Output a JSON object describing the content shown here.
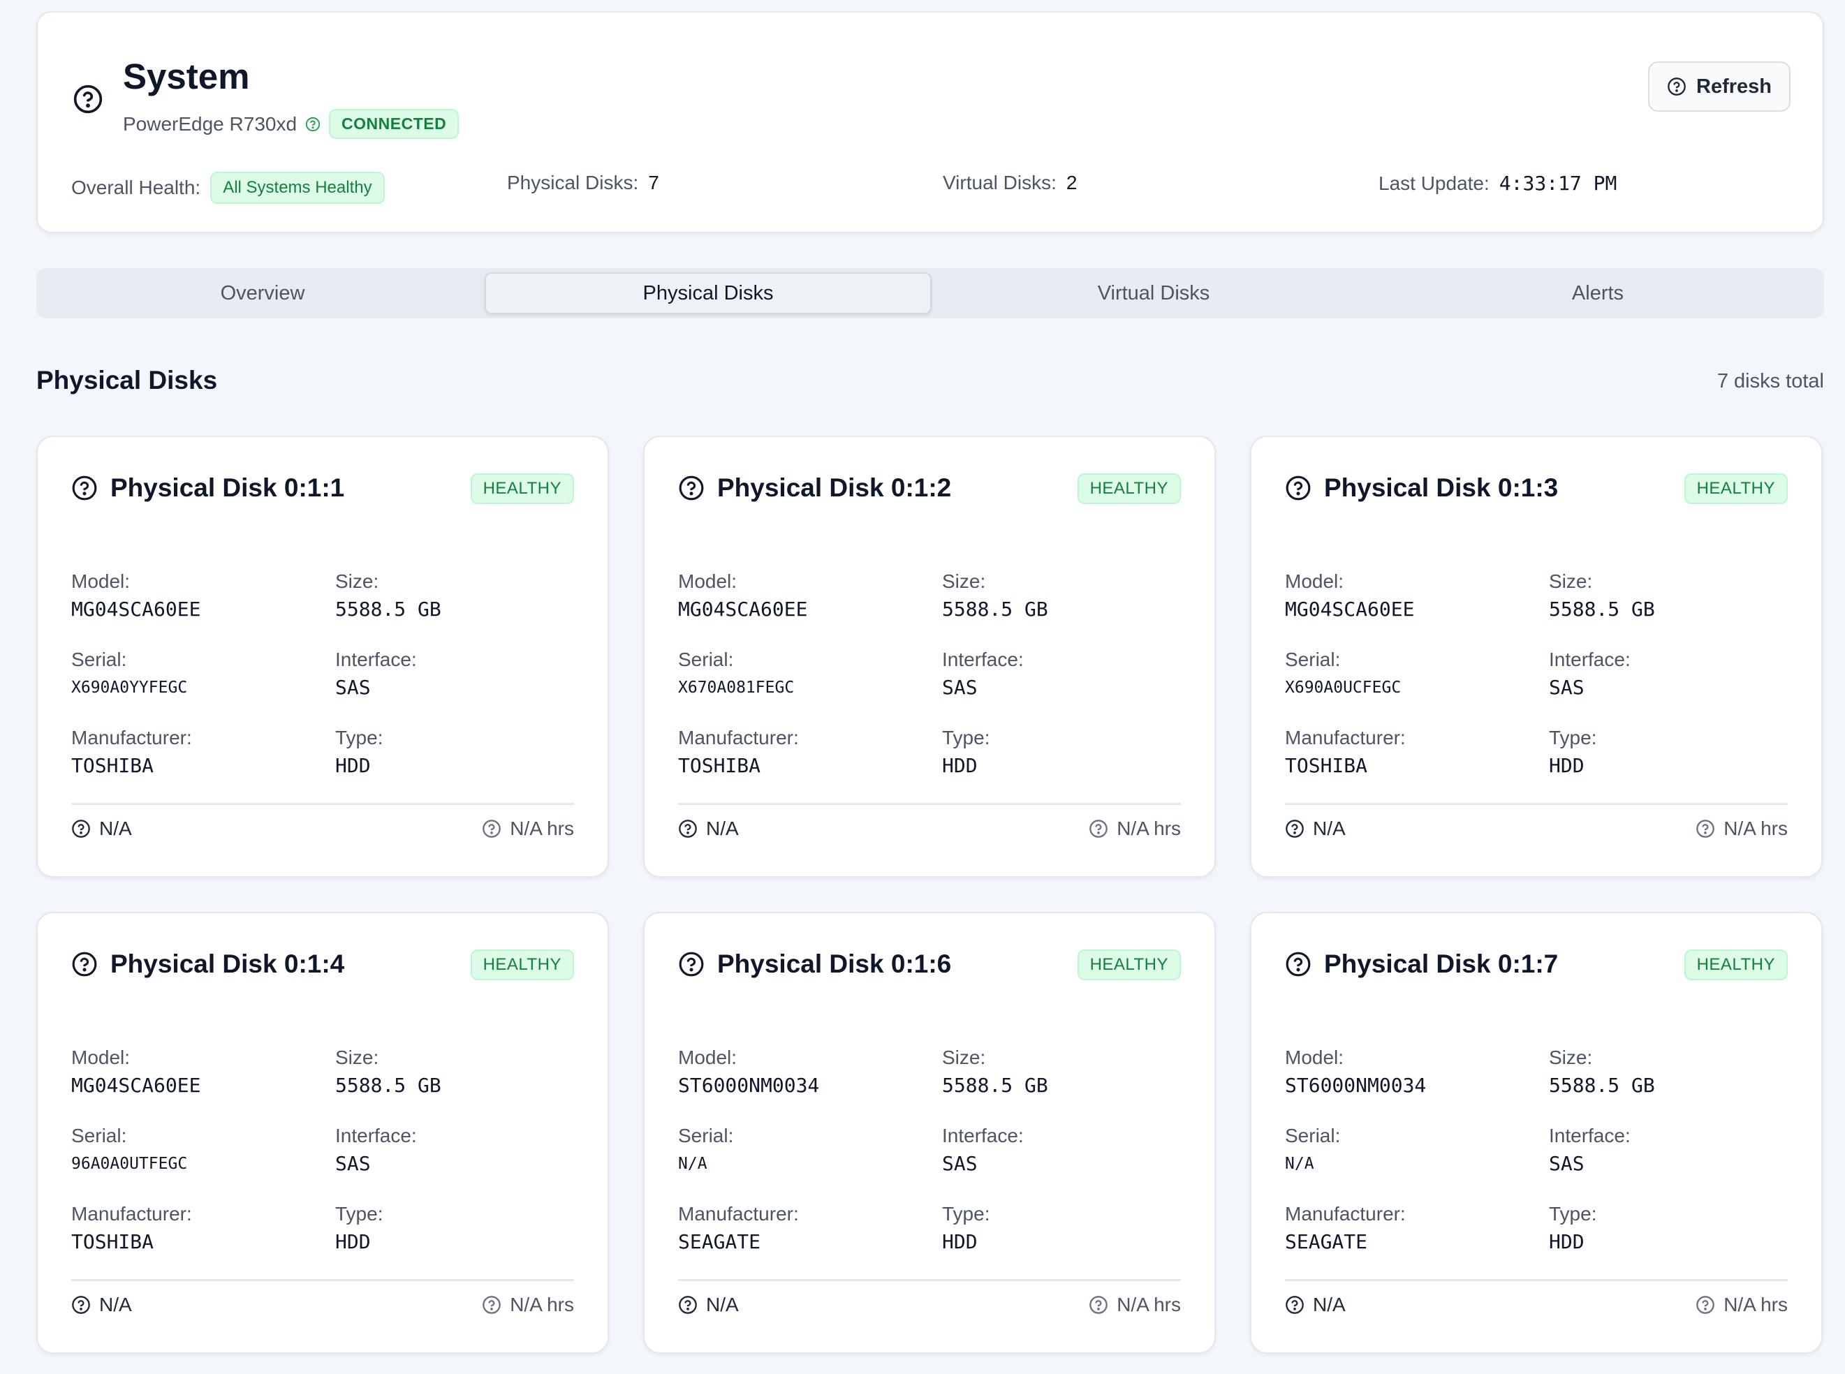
{
  "system": {
    "title": "System",
    "model": "PowerEdge R730xd",
    "connection_status": "CONNECTED",
    "refresh_label": "Refresh",
    "stats": {
      "overall_health_label": "Overall Health:",
      "overall_health_value": "All Systems Healthy",
      "physical_disks_label": "Physical Disks:",
      "physical_disks_value": "7",
      "virtual_disks_label": "Virtual Disks:",
      "virtual_disks_value": "2",
      "last_update_label": "Last Update:",
      "last_update_value": "4:33:17 PM"
    }
  },
  "tabs": [
    {
      "label": "Overview",
      "active": false
    },
    {
      "label": "Physical Disks",
      "active": true
    },
    {
      "label": "Virtual Disks",
      "active": false
    },
    {
      "label": "Alerts",
      "active": false
    }
  ],
  "section": {
    "title": "Physical Disks",
    "count": "7 disks total"
  },
  "field_labels": {
    "model": "Model:",
    "size": "Size:",
    "serial": "Serial:",
    "interface": "Interface:",
    "manufacturer": "Manufacturer:",
    "type": "Type:"
  },
  "disks": [
    {
      "name": "Physical Disk 0:1:1",
      "status": "HEALTHY",
      "model": "MG04SCA60EE",
      "size": "5588.5 GB",
      "serial": "X690A0YYFEGC",
      "interface": "SAS",
      "manufacturer": "TOSHIBA",
      "type": "HDD",
      "footer_left": "N/A",
      "footer_right": "N/A hrs"
    },
    {
      "name": "Physical Disk 0:1:2",
      "status": "HEALTHY",
      "model": "MG04SCA60EE",
      "size": "5588.5 GB",
      "serial": "X670A081FEGC",
      "interface": "SAS",
      "manufacturer": "TOSHIBA",
      "type": "HDD",
      "footer_left": "N/A",
      "footer_right": "N/A hrs"
    },
    {
      "name": "Physical Disk 0:1:3",
      "status": "HEALTHY",
      "model": "MG04SCA60EE",
      "size": "5588.5 GB",
      "serial": "X690A0UCFEGC",
      "interface": "SAS",
      "manufacturer": "TOSHIBA",
      "type": "HDD",
      "footer_left": "N/A",
      "footer_right": "N/A hrs"
    },
    {
      "name": "Physical Disk 0:1:4",
      "status": "HEALTHY",
      "model": "MG04SCA60EE",
      "size": "5588.5 GB",
      "serial": "96A0A0UTFEGC",
      "interface": "SAS",
      "manufacturer": "TOSHIBA",
      "type": "HDD",
      "footer_left": "N/A",
      "footer_right": "N/A hrs"
    },
    {
      "name": "Physical Disk 0:1:6",
      "status": "HEALTHY",
      "model": "ST6000NM0034",
      "size": "5588.5 GB",
      "serial": "N/A",
      "interface": "SAS",
      "manufacturer": "SEAGATE",
      "type": "HDD",
      "footer_left": "N/A",
      "footer_right": "N/A hrs"
    },
    {
      "name": "Physical Disk 0:1:7",
      "status": "HEALTHY",
      "model": "ST6000NM0034",
      "size": "5588.5 GB",
      "serial": "N/A",
      "interface": "SAS",
      "manufacturer": "SEAGATE",
      "type": "HDD",
      "footer_left": "N/A",
      "footer_right": "N/A hrs"
    }
  ],
  "colors": {
    "background": "#f3f6fb",
    "healthy_text": "#15803d",
    "healthy_bg": "#dcfce7"
  },
  "icons": {
    "system": "help-circle-icon",
    "connection": "help-circle-icon",
    "refresh": "help-circle-icon",
    "disk": "help-circle-icon",
    "temperature": "help-circle-icon",
    "hours": "help-circle-icon"
  }
}
